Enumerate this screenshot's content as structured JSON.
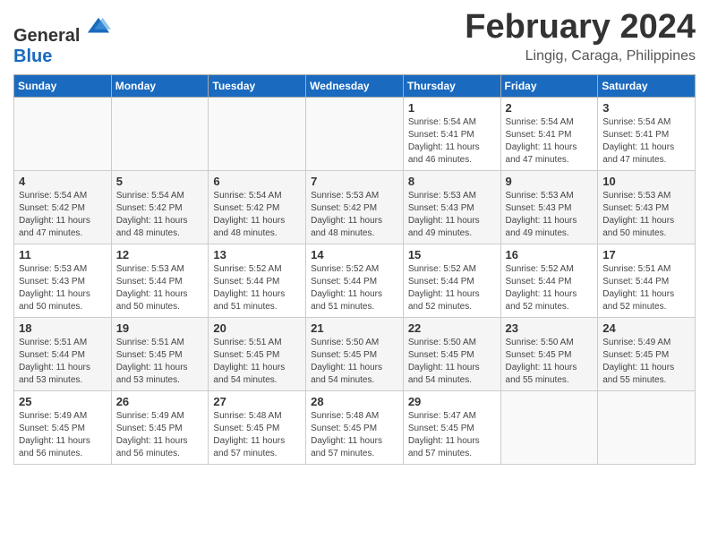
{
  "logo": {
    "general": "General",
    "blue": "Blue"
  },
  "title": "February 2024",
  "location": "Lingig, Caraga, Philippines",
  "days_header": [
    "Sunday",
    "Monday",
    "Tuesday",
    "Wednesday",
    "Thursday",
    "Friday",
    "Saturday"
  ],
  "weeks": [
    [
      {
        "num": "",
        "info": ""
      },
      {
        "num": "",
        "info": ""
      },
      {
        "num": "",
        "info": ""
      },
      {
        "num": "",
        "info": ""
      },
      {
        "num": "1",
        "info": "Sunrise: 5:54 AM\nSunset: 5:41 PM\nDaylight: 11 hours\nand 46 minutes."
      },
      {
        "num": "2",
        "info": "Sunrise: 5:54 AM\nSunset: 5:41 PM\nDaylight: 11 hours\nand 47 minutes."
      },
      {
        "num": "3",
        "info": "Sunrise: 5:54 AM\nSunset: 5:41 PM\nDaylight: 11 hours\nand 47 minutes."
      }
    ],
    [
      {
        "num": "4",
        "info": "Sunrise: 5:54 AM\nSunset: 5:42 PM\nDaylight: 11 hours\nand 47 minutes."
      },
      {
        "num": "5",
        "info": "Sunrise: 5:54 AM\nSunset: 5:42 PM\nDaylight: 11 hours\nand 48 minutes."
      },
      {
        "num": "6",
        "info": "Sunrise: 5:54 AM\nSunset: 5:42 PM\nDaylight: 11 hours\nand 48 minutes."
      },
      {
        "num": "7",
        "info": "Sunrise: 5:53 AM\nSunset: 5:42 PM\nDaylight: 11 hours\nand 48 minutes."
      },
      {
        "num": "8",
        "info": "Sunrise: 5:53 AM\nSunset: 5:43 PM\nDaylight: 11 hours\nand 49 minutes."
      },
      {
        "num": "9",
        "info": "Sunrise: 5:53 AM\nSunset: 5:43 PM\nDaylight: 11 hours\nand 49 minutes."
      },
      {
        "num": "10",
        "info": "Sunrise: 5:53 AM\nSunset: 5:43 PM\nDaylight: 11 hours\nand 50 minutes."
      }
    ],
    [
      {
        "num": "11",
        "info": "Sunrise: 5:53 AM\nSunset: 5:43 PM\nDaylight: 11 hours\nand 50 minutes."
      },
      {
        "num": "12",
        "info": "Sunrise: 5:53 AM\nSunset: 5:44 PM\nDaylight: 11 hours\nand 50 minutes."
      },
      {
        "num": "13",
        "info": "Sunrise: 5:52 AM\nSunset: 5:44 PM\nDaylight: 11 hours\nand 51 minutes."
      },
      {
        "num": "14",
        "info": "Sunrise: 5:52 AM\nSunset: 5:44 PM\nDaylight: 11 hours\nand 51 minutes."
      },
      {
        "num": "15",
        "info": "Sunrise: 5:52 AM\nSunset: 5:44 PM\nDaylight: 11 hours\nand 52 minutes."
      },
      {
        "num": "16",
        "info": "Sunrise: 5:52 AM\nSunset: 5:44 PM\nDaylight: 11 hours\nand 52 minutes."
      },
      {
        "num": "17",
        "info": "Sunrise: 5:51 AM\nSunset: 5:44 PM\nDaylight: 11 hours\nand 52 minutes."
      }
    ],
    [
      {
        "num": "18",
        "info": "Sunrise: 5:51 AM\nSunset: 5:44 PM\nDaylight: 11 hours\nand 53 minutes."
      },
      {
        "num": "19",
        "info": "Sunrise: 5:51 AM\nSunset: 5:45 PM\nDaylight: 11 hours\nand 53 minutes."
      },
      {
        "num": "20",
        "info": "Sunrise: 5:51 AM\nSunset: 5:45 PM\nDaylight: 11 hours\nand 54 minutes."
      },
      {
        "num": "21",
        "info": "Sunrise: 5:50 AM\nSunset: 5:45 PM\nDaylight: 11 hours\nand 54 minutes."
      },
      {
        "num": "22",
        "info": "Sunrise: 5:50 AM\nSunset: 5:45 PM\nDaylight: 11 hours\nand 54 minutes."
      },
      {
        "num": "23",
        "info": "Sunrise: 5:50 AM\nSunset: 5:45 PM\nDaylight: 11 hours\nand 55 minutes."
      },
      {
        "num": "24",
        "info": "Sunrise: 5:49 AM\nSunset: 5:45 PM\nDaylight: 11 hours\nand 55 minutes."
      }
    ],
    [
      {
        "num": "25",
        "info": "Sunrise: 5:49 AM\nSunset: 5:45 PM\nDaylight: 11 hours\nand 56 minutes."
      },
      {
        "num": "26",
        "info": "Sunrise: 5:49 AM\nSunset: 5:45 PM\nDaylight: 11 hours\nand 56 minutes."
      },
      {
        "num": "27",
        "info": "Sunrise: 5:48 AM\nSunset: 5:45 PM\nDaylight: 11 hours\nand 57 minutes."
      },
      {
        "num": "28",
        "info": "Sunrise: 5:48 AM\nSunset: 5:45 PM\nDaylight: 11 hours\nand 57 minutes."
      },
      {
        "num": "29",
        "info": "Sunrise: 5:47 AM\nSunset: 5:45 PM\nDaylight: 11 hours\nand 57 minutes."
      },
      {
        "num": "",
        "info": ""
      },
      {
        "num": "",
        "info": ""
      }
    ]
  ]
}
